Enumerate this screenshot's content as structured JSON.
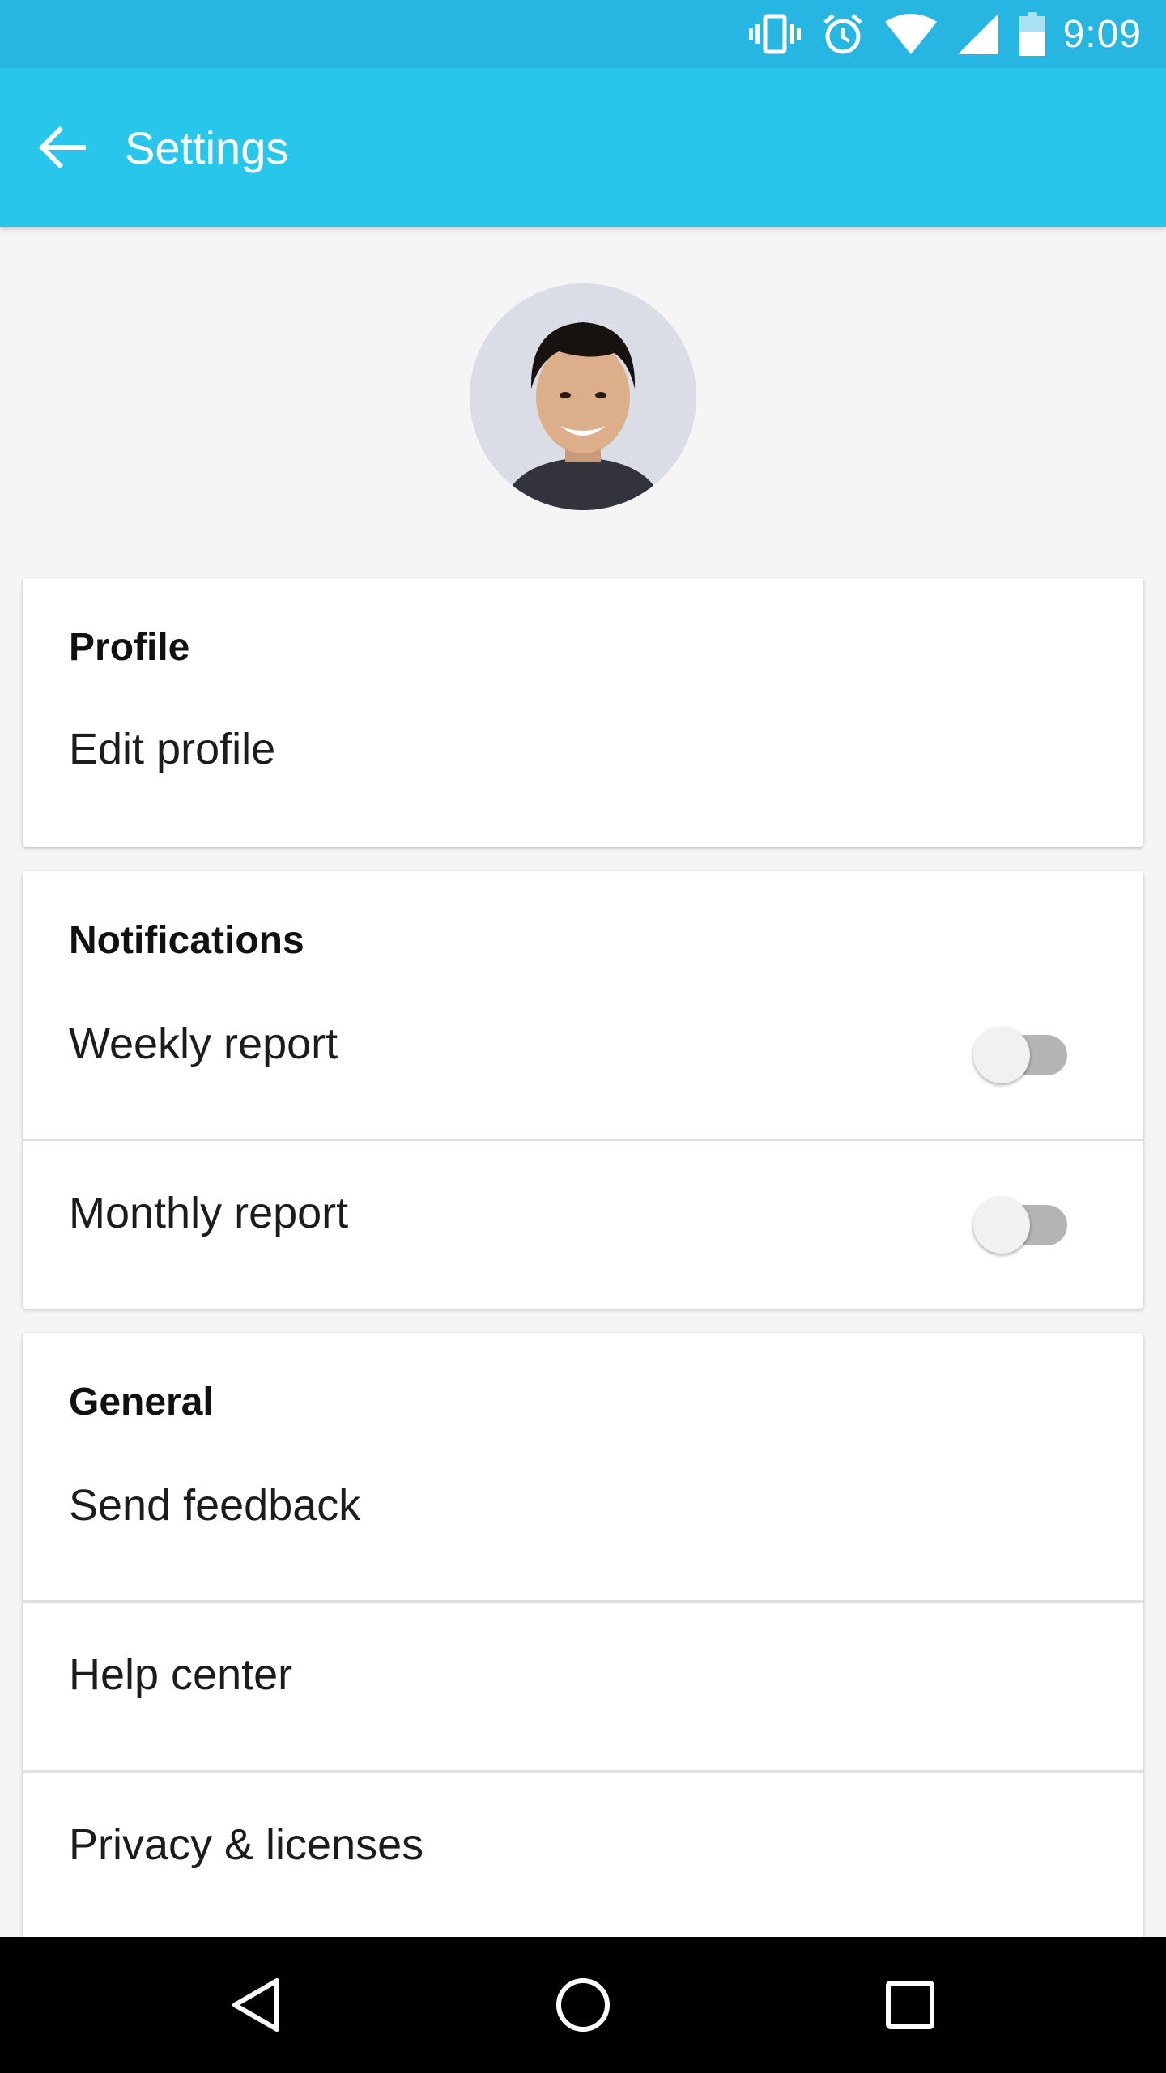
{
  "status_bar": {
    "time": "9:09",
    "icons": [
      "vibrate-icon",
      "alarm-icon",
      "wifi-icon",
      "cellular-signal-icon",
      "battery-icon"
    ]
  },
  "app_bar": {
    "title": "Settings",
    "back_icon": "arrow-left-icon",
    "color": "#28c6eb"
  },
  "profile_card": {
    "header": "Profile",
    "items": [
      {
        "label": "Edit profile"
      }
    ]
  },
  "notifications_card": {
    "header": "Notifications",
    "items": [
      {
        "label": "Weekly report",
        "toggle_on": false
      },
      {
        "label": "Monthly report",
        "toggle_on": false
      }
    ]
  },
  "general_card": {
    "header": "General",
    "items": [
      {
        "label": "Send feedback"
      },
      {
        "label": "Help center"
      },
      {
        "label": "Privacy & licenses"
      }
    ]
  },
  "nav_bar": {
    "icons": [
      "back-triangle-icon",
      "home-circle-icon",
      "recents-square-icon"
    ]
  }
}
